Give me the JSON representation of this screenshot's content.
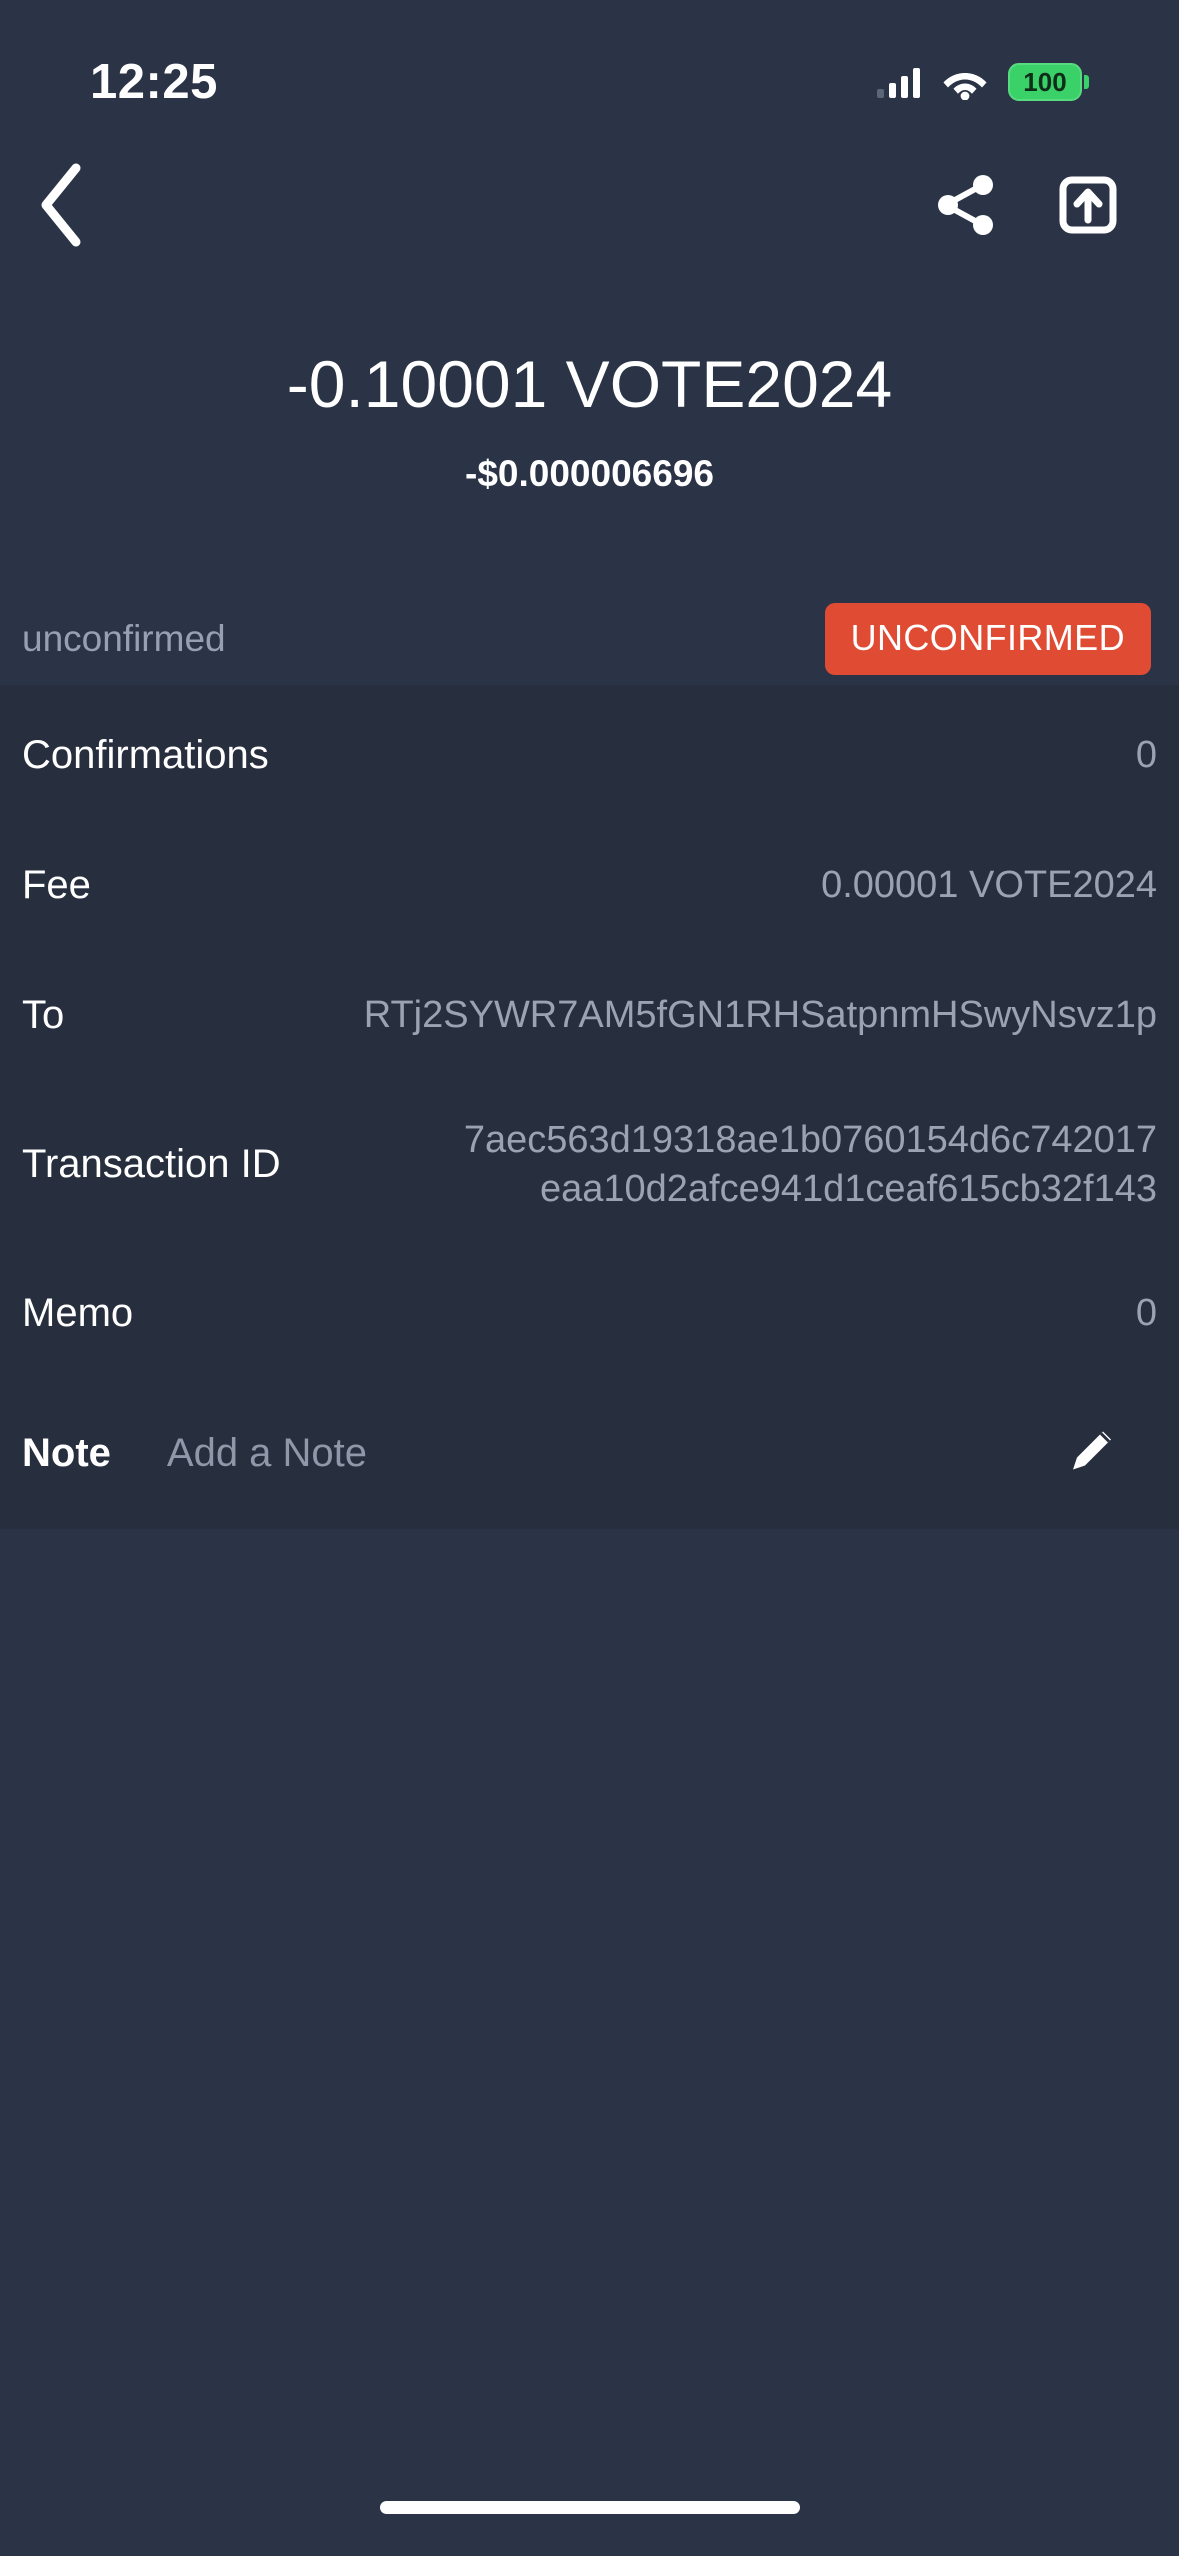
{
  "statusbar": {
    "time": "12:25",
    "battery_level": "100",
    "signal_icon": "cellular-signal-icon",
    "wifi_icon": "wifi-icon",
    "battery_icon": "battery-icon",
    "battery_color": "#3ad168"
  },
  "navbar": {
    "back_icon": "back-chevron-icon",
    "share_icon": "share-icon",
    "open_external_icon": "open-external-icon"
  },
  "transaction": {
    "amount": "-0.10001 VOTE2024",
    "fiat_amount": "-$0.000006696",
    "status_label": "unconfirmed",
    "status_badge": "UNCONFIRMED",
    "badge_color": "#e04b34"
  },
  "details": [
    {
      "label": "Confirmations",
      "value": "0"
    },
    {
      "label": "Fee",
      "value": "0.00001 VOTE2024"
    },
    {
      "label": "To",
      "value": "RTj2SYWR7AM5fGN1RHSatpnmHSwyNsvz1p"
    },
    {
      "label": "Transaction ID",
      "value": "7aec563d19318ae1b0760154d6c742017eaa10d2afce941d1ceaf615cb32f143"
    },
    {
      "label": "Memo",
      "value": "0"
    }
  ],
  "note": {
    "label": "Note",
    "placeholder": "Add a Note",
    "edit_icon": "pencil-edit-icon"
  },
  "theme": {
    "background": "#2b3446",
    "details_background": "#272e3e",
    "text_primary": "#ffffff",
    "text_secondary": "#9aa3b2"
  }
}
